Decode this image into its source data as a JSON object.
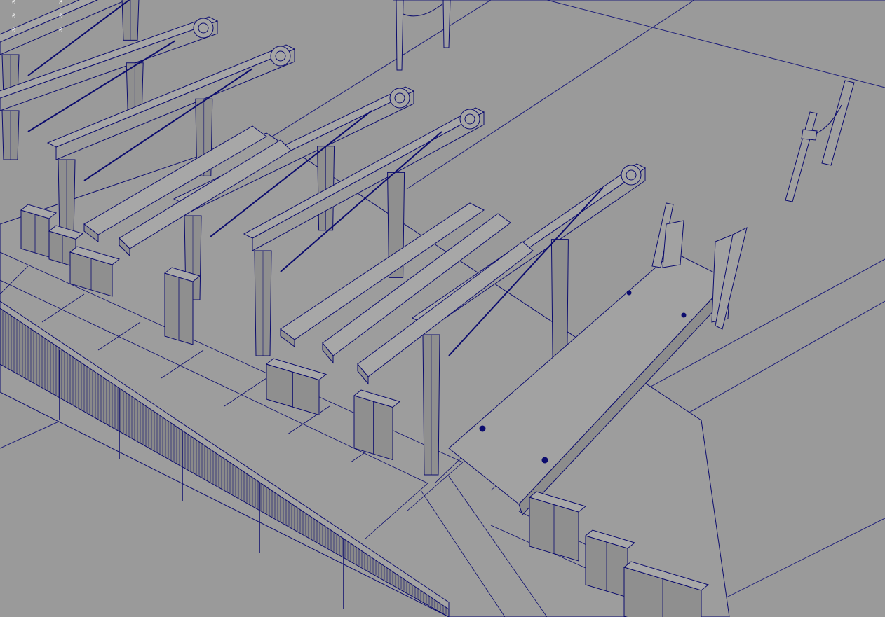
{
  "viewport": {
    "background": "#9a9a9a",
    "wire_color": "#0c0c6e",
    "grid_color": "#1e1e7a",
    "face_color": "#9c9c9c",
    "face_dark": "#8f8f8f",
    "display_mode": "wireframe-on-shaded"
  },
  "hud": {
    "rows": [
      {
        "a": "0",
        "b": "8"
      },
      {
        "a": "0",
        "b": "0"
      },
      {
        "a": "0",
        "b": "0"
      }
    ]
  }
}
